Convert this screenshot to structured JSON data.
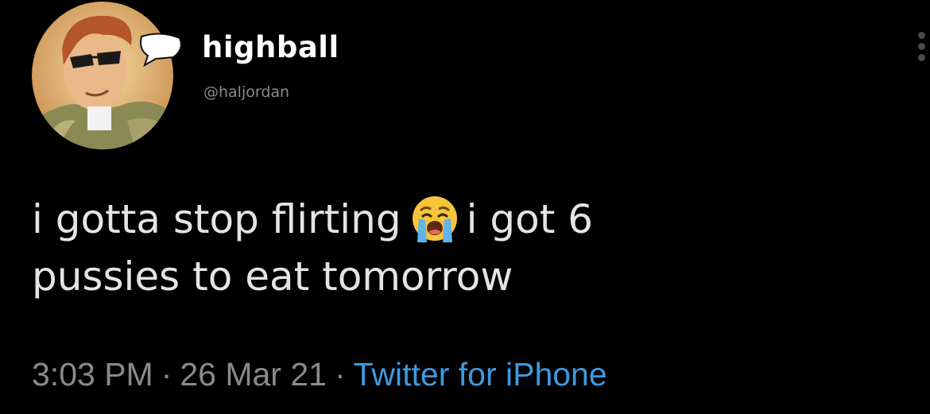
{
  "user": {
    "display_name": "highball",
    "handle": "@haljordan"
  },
  "tweet": {
    "line1_before_emoji": "i gotta stop flirting",
    "emoji": "loudly-crying-face",
    "line1_after_emoji": "i got 6",
    "line2": "pussies to eat tomorrow"
  },
  "meta": {
    "time": "3:03 PM",
    "separator": "·",
    "date": "26 Mar 21",
    "source": "Twitter for iPhone"
  },
  "colors": {
    "background": "#000000",
    "text": "#e4e4e4",
    "muted": "#8a8a8a",
    "link": "#3d9ae0"
  }
}
